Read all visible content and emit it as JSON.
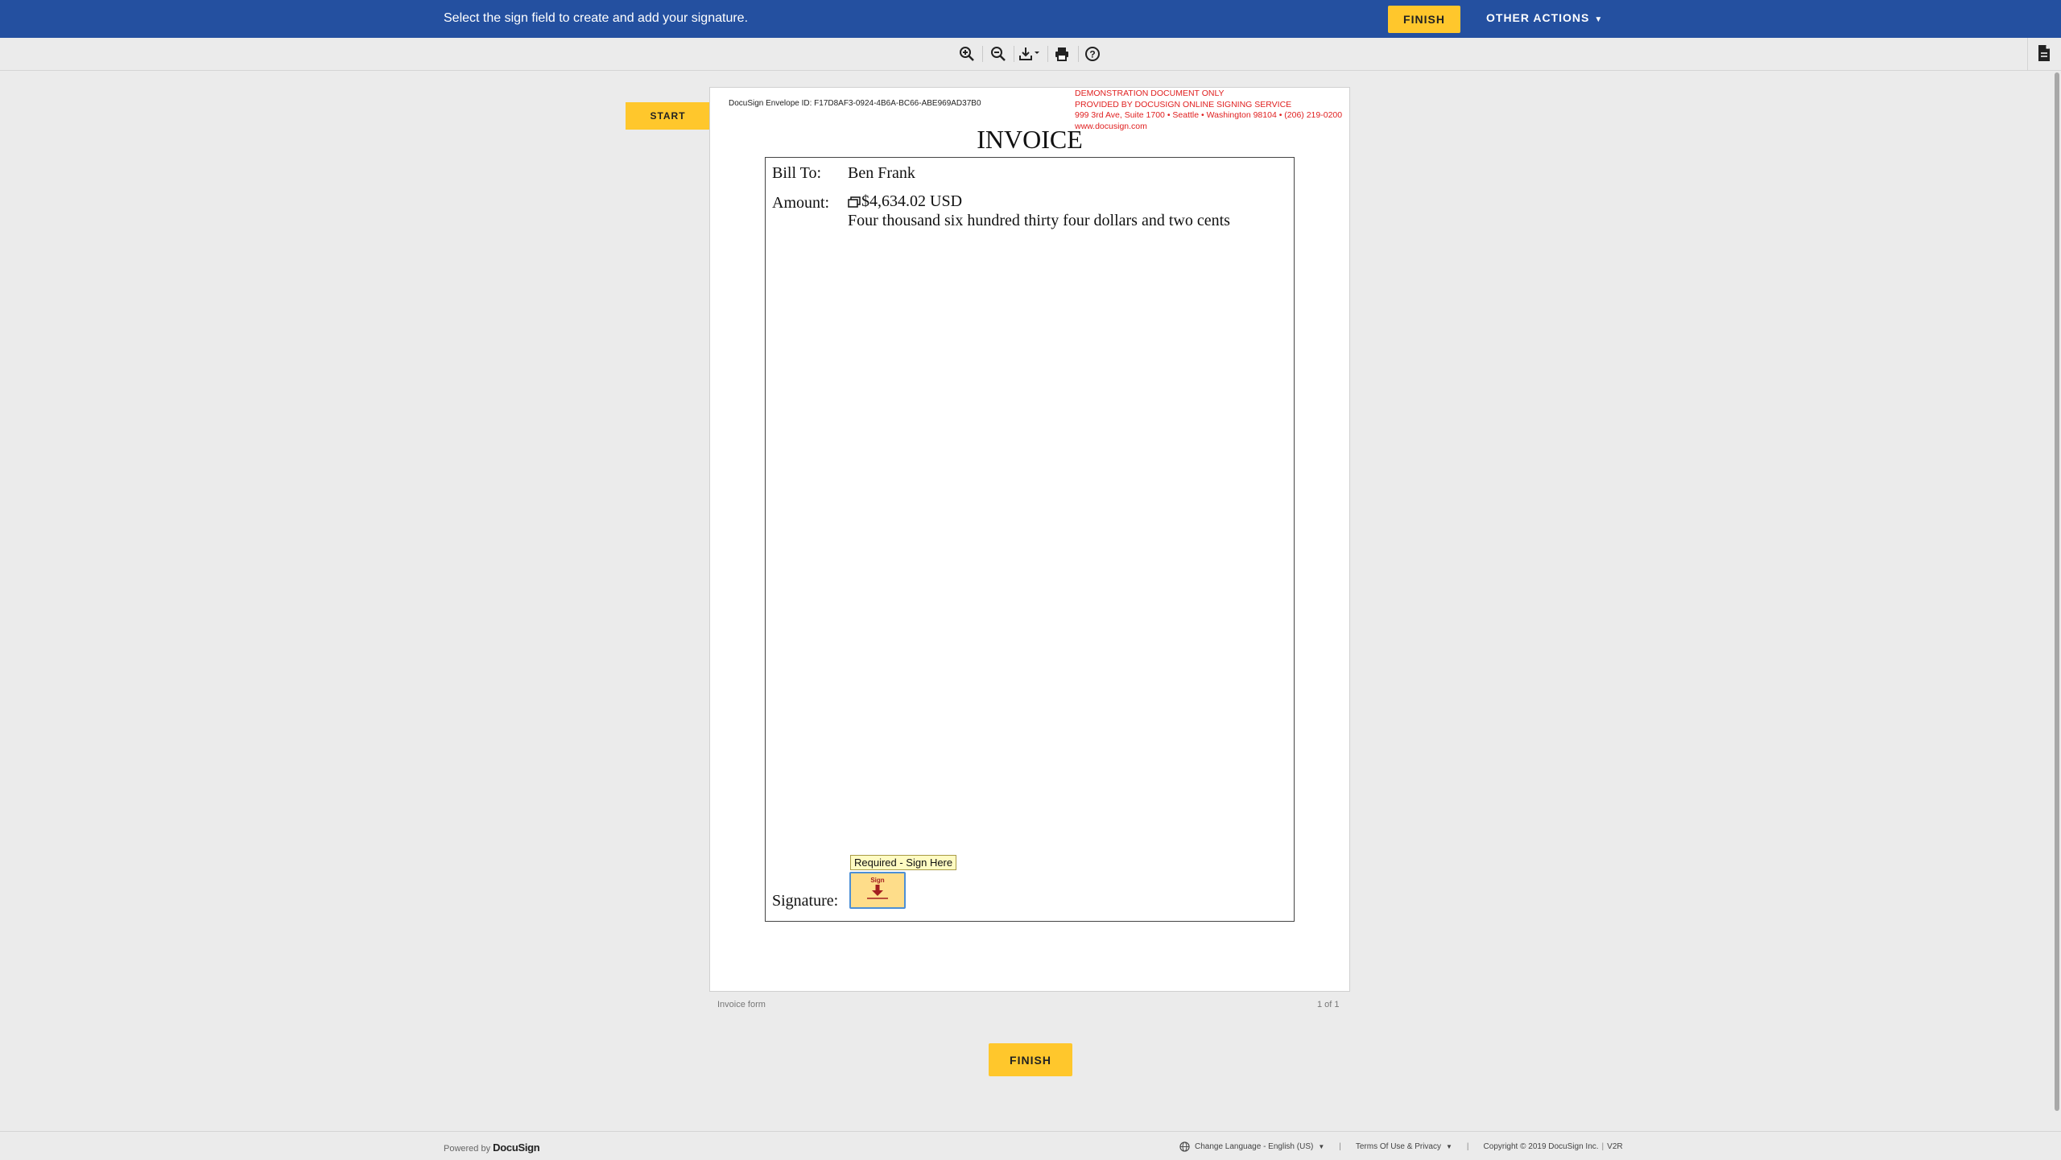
{
  "topbar": {
    "message": "Select the sign field to create and add your signature.",
    "finish_label": "FINISH",
    "other_actions_label": "OTHER ACTIONS",
    "accent_color": "#2450a0",
    "button_color": "#ffc72c"
  },
  "toolbar": {
    "icons": [
      "zoom-in-icon",
      "zoom-out-icon",
      "download-icon",
      "print-icon",
      "help-icon",
      "document-icon"
    ]
  },
  "start_label": "START",
  "document": {
    "envelope_id": "DocuSign Envelope ID: F17D8AF3-0924-4B6A-BC66-ABE969AD37B0",
    "demo_lines": [
      "DEMONSTRATION DOCUMENT ONLY",
      "PROVIDED BY DOCUSIGN ONLINE SIGNING SERVICE",
      "999 3rd Ave, Suite 1700  • Seattle • Washington 98104 • (206) 219-0200",
      "www.docusign.com"
    ],
    "title": "INVOICE",
    "bill_to_label": "Bill To:",
    "bill_to_value": "Ben Frank",
    "amount_label": "Amount:",
    "amount_value": "$4,634.02 USD",
    "amount_words": "Four thousand six hundred thirty four dollars and two cents",
    "signature_label": "Signature:",
    "sign_tooltip": "Required - Sign Here",
    "sign_field_text": "Sign",
    "name": "Invoice form",
    "page_count": "1 of 1"
  },
  "finish_bottom_label": "FINISH",
  "footer": {
    "powered_prefix": "Powered by",
    "powered_brand": "DocuSign",
    "language": "Change Language - English (US)",
    "terms": "Terms Of Use & Privacy",
    "copyright": "Copyright © 2019 DocuSign Inc.",
    "version": "V2R"
  }
}
